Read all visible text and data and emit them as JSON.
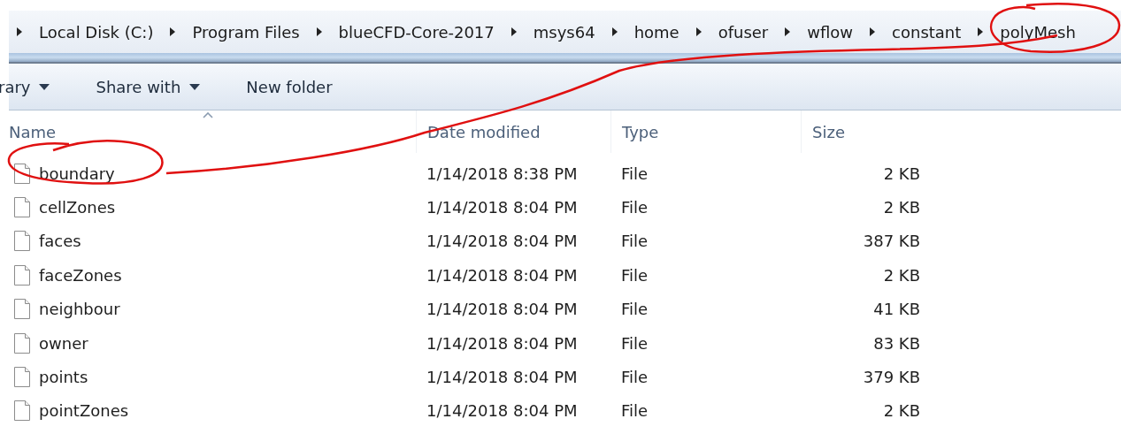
{
  "breadcrumb": [
    "Local Disk (C:)",
    "Program Files",
    "blueCFD-Core-2017",
    "msys64",
    "home",
    "ofuser",
    "wflow",
    "constant",
    "polyMesh"
  ],
  "toolbar": [
    {
      "label": "rary",
      "kind": "dropdown"
    },
    {
      "label": "Share with",
      "kind": "dropdown"
    },
    {
      "label": "New folder",
      "kind": "button"
    }
  ],
  "table": {
    "columns": [
      {
        "label": "Name",
        "sorted": true
      },
      {
        "label": "Date modified",
        "sorted": false
      },
      {
        "label": "Type",
        "sorted": false
      },
      {
        "label": "Size",
        "sorted": false
      }
    ],
    "rows": [
      {
        "name": "boundary",
        "date": "1/14/2018 8:38 PM",
        "type": "File",
        "size": "2 KB"
      },
      {
        "name": "cellZones",
        "date": "1/14/2018 8:04 PM",
        "type": "File",
        "size": "2 KB"
      },
      {
        "name": "faces",
        "date": "1/14/2018 8:04 PM",
        "type": "File",
        "size": "387 KB"
      },
      {
        "name": "faceZones",
        "date": "1/14/2018 8:04 PM",
        "type": "File",
        "size": "2 KB"
      },
      {
        "name": "neighbour",
        "date": "1/14/2018 8:04 PM",
        "type": "File",
        "size": "41 KB"
      },
      {
        "name": "owner",
        "date": "1/14/2018 8:04 PM",
        "type": "File",
        "size": "83 KB"
      },
      {
        "name": "points",
        "date": "1/14/2018 8:04 PM",
        "type": "File",
        "size": "379 KB"
      },
      {
        "name": "pointZones",
        "date": "1/14/2018 8:04 PM",
        "type": "File",
        "size": "2 KB"
      }
    ]
  }
}
